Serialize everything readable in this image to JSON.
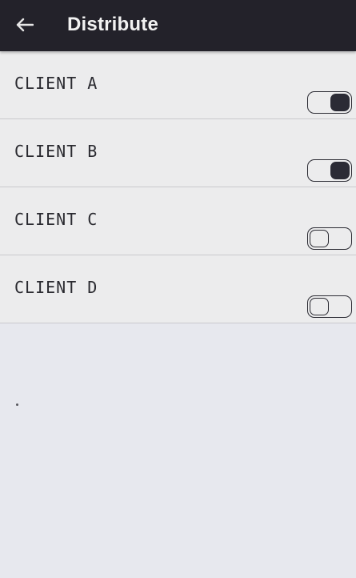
{
  "app_bar": {
    "title": "Distribute",
    "back_icon": "arrow-left-icon",
    "background": "#23222a"
  },
  "clients": [
    {
      "label": "CLIENT A",
      "enabled": true
    },
    {
      "label": "CLIENT B",
      "enabled": true
    },
    {
      "label": "CLIENT C",
      "enabled": false
    },
    {
      "label": "CLIENT D",
      "enabled": false
    }
  ]
}
